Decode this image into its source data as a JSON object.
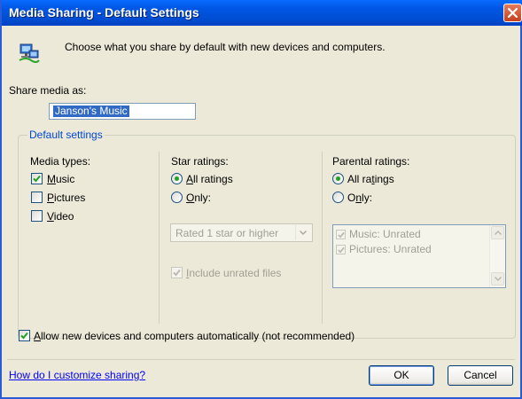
{
  "window": {
    "title": "Media Sharing - Default Settings"
  },
  "intro": {
    "icon": "network-computers-icon",
    "text": "Choose what you share by default with new devices and computers."
  },
  "share_media_as": {
    "label": "Share media as:",
    "value": "Janson's Music"
  },
  "default_settings": {
    "label": "Default settings",
    "media_types": {
      "label": "Media types:",
      "items": [
        {
          "label": "Music",
          "checked": true
        },
        {
          "label": "Pictures",
          "checked": false
        },
        {
          "label": "Video",
          "checked": false
        }
      ]
    },
    "star_ratings": {
      "label": "Star ratings:",
      "all_label": "All ratings",
      "only_label": "Only:",
      "selected": "All ratings",
      "combo_value": "Rated 1 star or higher",
      "include_unrated_label": "Include unrated files",
      "include_unrated_checked": true
    },
    "parental_ratings": {
      "label": "Parental ratings:",
      "all_label": "All ratings",
      "only_label": "Only:",
      "selected": "All ratings",
      "list_items": [
        {
          "label": "Music: Unrated",
          "checked": true
        },
        {
          "label": "Pictures: Unrated",
          "checked": true
        }
      ]
    }
  },
  "allow_new_devices": {
    "label": "Allow new devices and computers automatically (not recommended)",
    "checked": true
  },
  "footer": {
    "help_link": "How do I customize sharing?",
    "ok_label": "OK",
    "cancel_label": "Cancel"
  },
  "colors": {
    "title_bar": "#0054e3",
    "group_label": "#0046d5",
    "link": "#0000ff",
    "selection": "#316ac5",
    "radio_dot": "#21a121"
  }
}
